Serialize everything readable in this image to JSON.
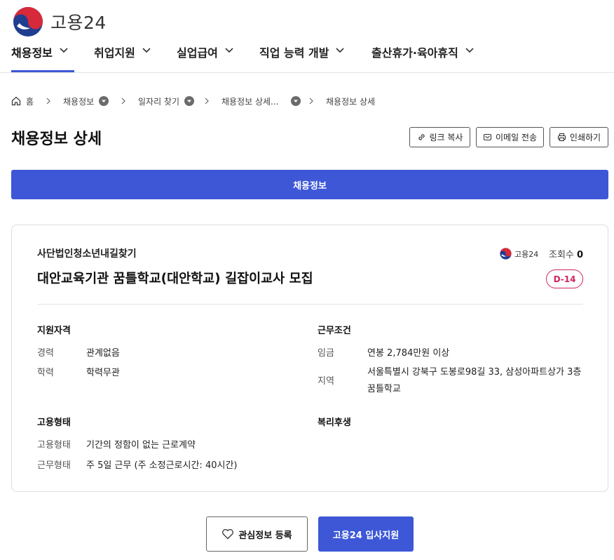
{
  "header": {
    "logo_text": "고용24",
    "nav": [
      {
        "label": "채용정보",
        "active": true
      },
      {
        "label": "취업지원"
      },
      {
        "label": "실업급여"
      },
      {
        "label": "직업 능력 개발"
      },
      {
        "label": "출산휴가·육아휴직"
      }
    ],
    "accent_color": "#3d57d7"
  },
  "breadcrumb": {
    "home": "홈",
    "items": [
      "채용정보",
      "일자리 찾기",
      "채용정보 상세...",
      "채용정보 상세"
    ]
  },
  "page": {
    "title": "채용정보 상세",
    "actions": {
      "copy_link": "링크 복사",
      "email": "이메일 전송",
      "print": "인쇄하기"
    },
    "tab": "채용정보"
  },
  "job": {
    "company": "사단법인청소년내길찾기",
    "title": "대안교육기관 꿈틀학교(대안학교) 길잡이교사 모집",
    "source": "고용24",
    "views_label": "조회수",
    "views_count": "0",
    "dday": "D-14",
    "dday_color": "#d2245a",
    "qualification": {
      "title": "지원자격",
      "rows": [
        {
          "label": "경력",
          "value": "관계없음"
        },
        {
          "label": "학력",
          "value": "학력무관"
        }
      ]
    },
    "conditions": {
      "title": "근무조건",
      "rows": [
        {
          "label": "임금",
          "value": "연봉 2,784만원 이상"
        },
        {
          "label": "지역",
          "value": "서울특별시 강북구 도봉로98길 33, 삼성아파트상가 3층 꿈틀학교"
        }
      ]
    },
    "employment": {
      "title": "고용형태",
      "rows": [
        {
          "label": "고용형태",
          "value": "기간의 정함이 없는 근로계약"
        },
        {
          "label": "근무형태",
          "value": "주 5일 근무 (주 소정근로시간: 40시간)"
        }
      ]
    },
    "welfare": {
      "title": "복리후생"
    }
  },
  "buttons": {
    "favorite": "관심정보 등록",
    "apply": "고용24 입사지원"
  }
}
